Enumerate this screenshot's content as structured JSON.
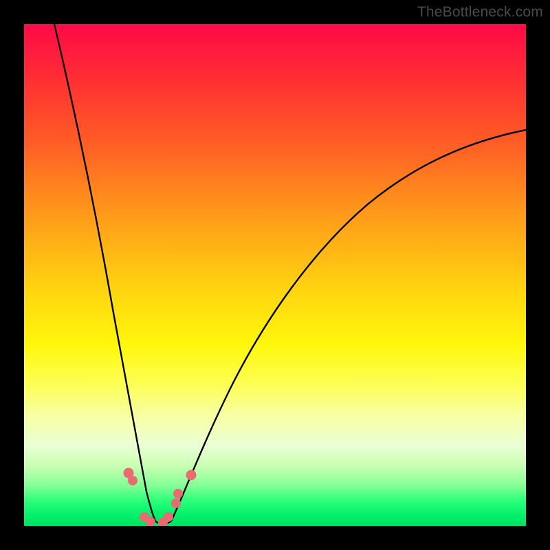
{
  "watermark": "TheBottleneck.com",
  "chart_data": {
    "type": "line",
    "title": "",
    "xlabel": "",
    "ylabel": "",
    "xlim": [
      0,
      100
    ],
    "ylim": [
      0,
      100
    ],
    "grid": false,
    "legend": false,
    "note": "Axes have no visible tick labels; values are normalized 0–100. Curve is a V-shape bottoming near x≈26 with the right arm shallower than the left.",
    "series": [
      {
        "name": "left-arm",
        "x": [
          6,
          8,
          10,
          12,
          14,
          16,
          18,
          20,
          22,
          23.5,
          25
        ],
        "y": [
          100,
          84,
          70,
          57,
          45,
          34,
          24,
          15,
          8,
          4,
          1
        ]
      },
      {
        "name": "right-arm",
        "x": [
          28,
          30,
          33,
          37,
          42,
          48,
          55,
          63,
          72,
          82,
          92,
          100
        ],
        "y": [
          1,
          4,
          9,
          16,
          25,
          35,
          45,
          54,
          62,
          69,
          75,
          79
        ]
      },
      {
        "name": "floor",
        "x": [
          25,
          26,
          27,
          28
        ],
        "y": [
          1,
          0,
          0,
          1
        ]
      }
    ],
    "markers": [
      {
        "x": 20.8,
        "y": 10.5
      },
      {
        "x": 21.6,
        "y": 9.0
      },
      {
        "x": 24.0,
        "y": 1.8
      },
      {
        "x": 25.2,
        "y": 0.8
      },
      {
        "x": 27.6,
        "y": 0.7
      },
      {
        "x": 28.7,
        "y": 1.8
      },
      {
        "x": 30.2,
        "y": 4.5
      },
      {
        "x": 30.6,
        "y": 6.5
      },
      {
        "x": 33.3,
        "y": 10.2
      }
    ],
    "marker_color": "#e96a6f",
    "curve_color": "#000000",
    "curve_width": 2
  }
}
